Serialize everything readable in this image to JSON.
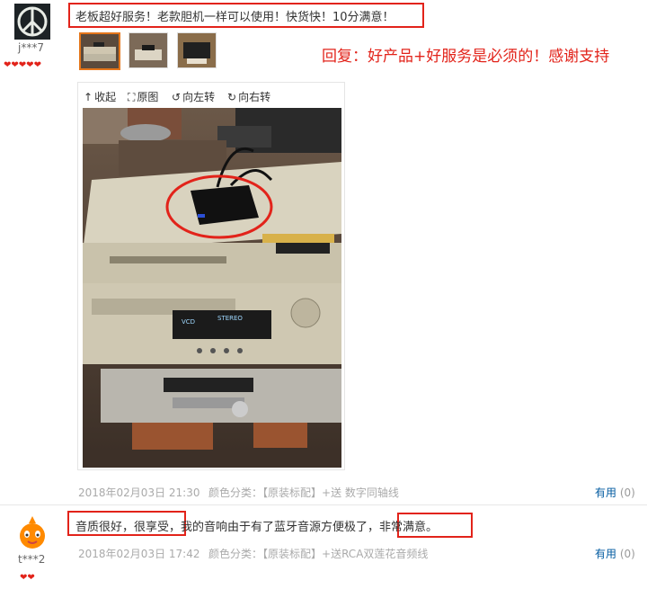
{
  "review1": {
    "user": "j***7",
    "text": "老板超好服务！老款胆机一样可以使用！快货快！10分满意！",
    "reply": "回复：好产品+好服务是必须的！感谢支持",
    "tools": {
      "collapse": "收起",
      "original": "原图",
      "rotate_left": "向左转",
      "rotate_right": "向右转"
    },
    "date": "2018年02月03日 21:30",
    "color_label": "颜色分类：",
    "color_value": "【原装标配】+送 数字同轴线",
    "useful_label": "有用",
    "useful_count": "(0)",
    "hearts": 5
  },
  "review2": {
    "user": "t***2",
    "text_part1": "音质很好，很享受",
    "text_part2": "，我的音响由于有了蓝牙音源方便极了，",
    "text_part3": "非常满意。",
    "date": "2018年02月03日 17:42",
    "color_label": "颜色分类：",
    "color_value": "【原装标配】+送RCA双莲花音频线",
    "useful_label": "有用",
    "useful_count": "(0)",
    "hearts": 2
  },
  "colors": {
    "accent_red": "#e2231a",
    "link_blue": "#005aa0",
    "thumb_active": "#e4761b"
  }
}
